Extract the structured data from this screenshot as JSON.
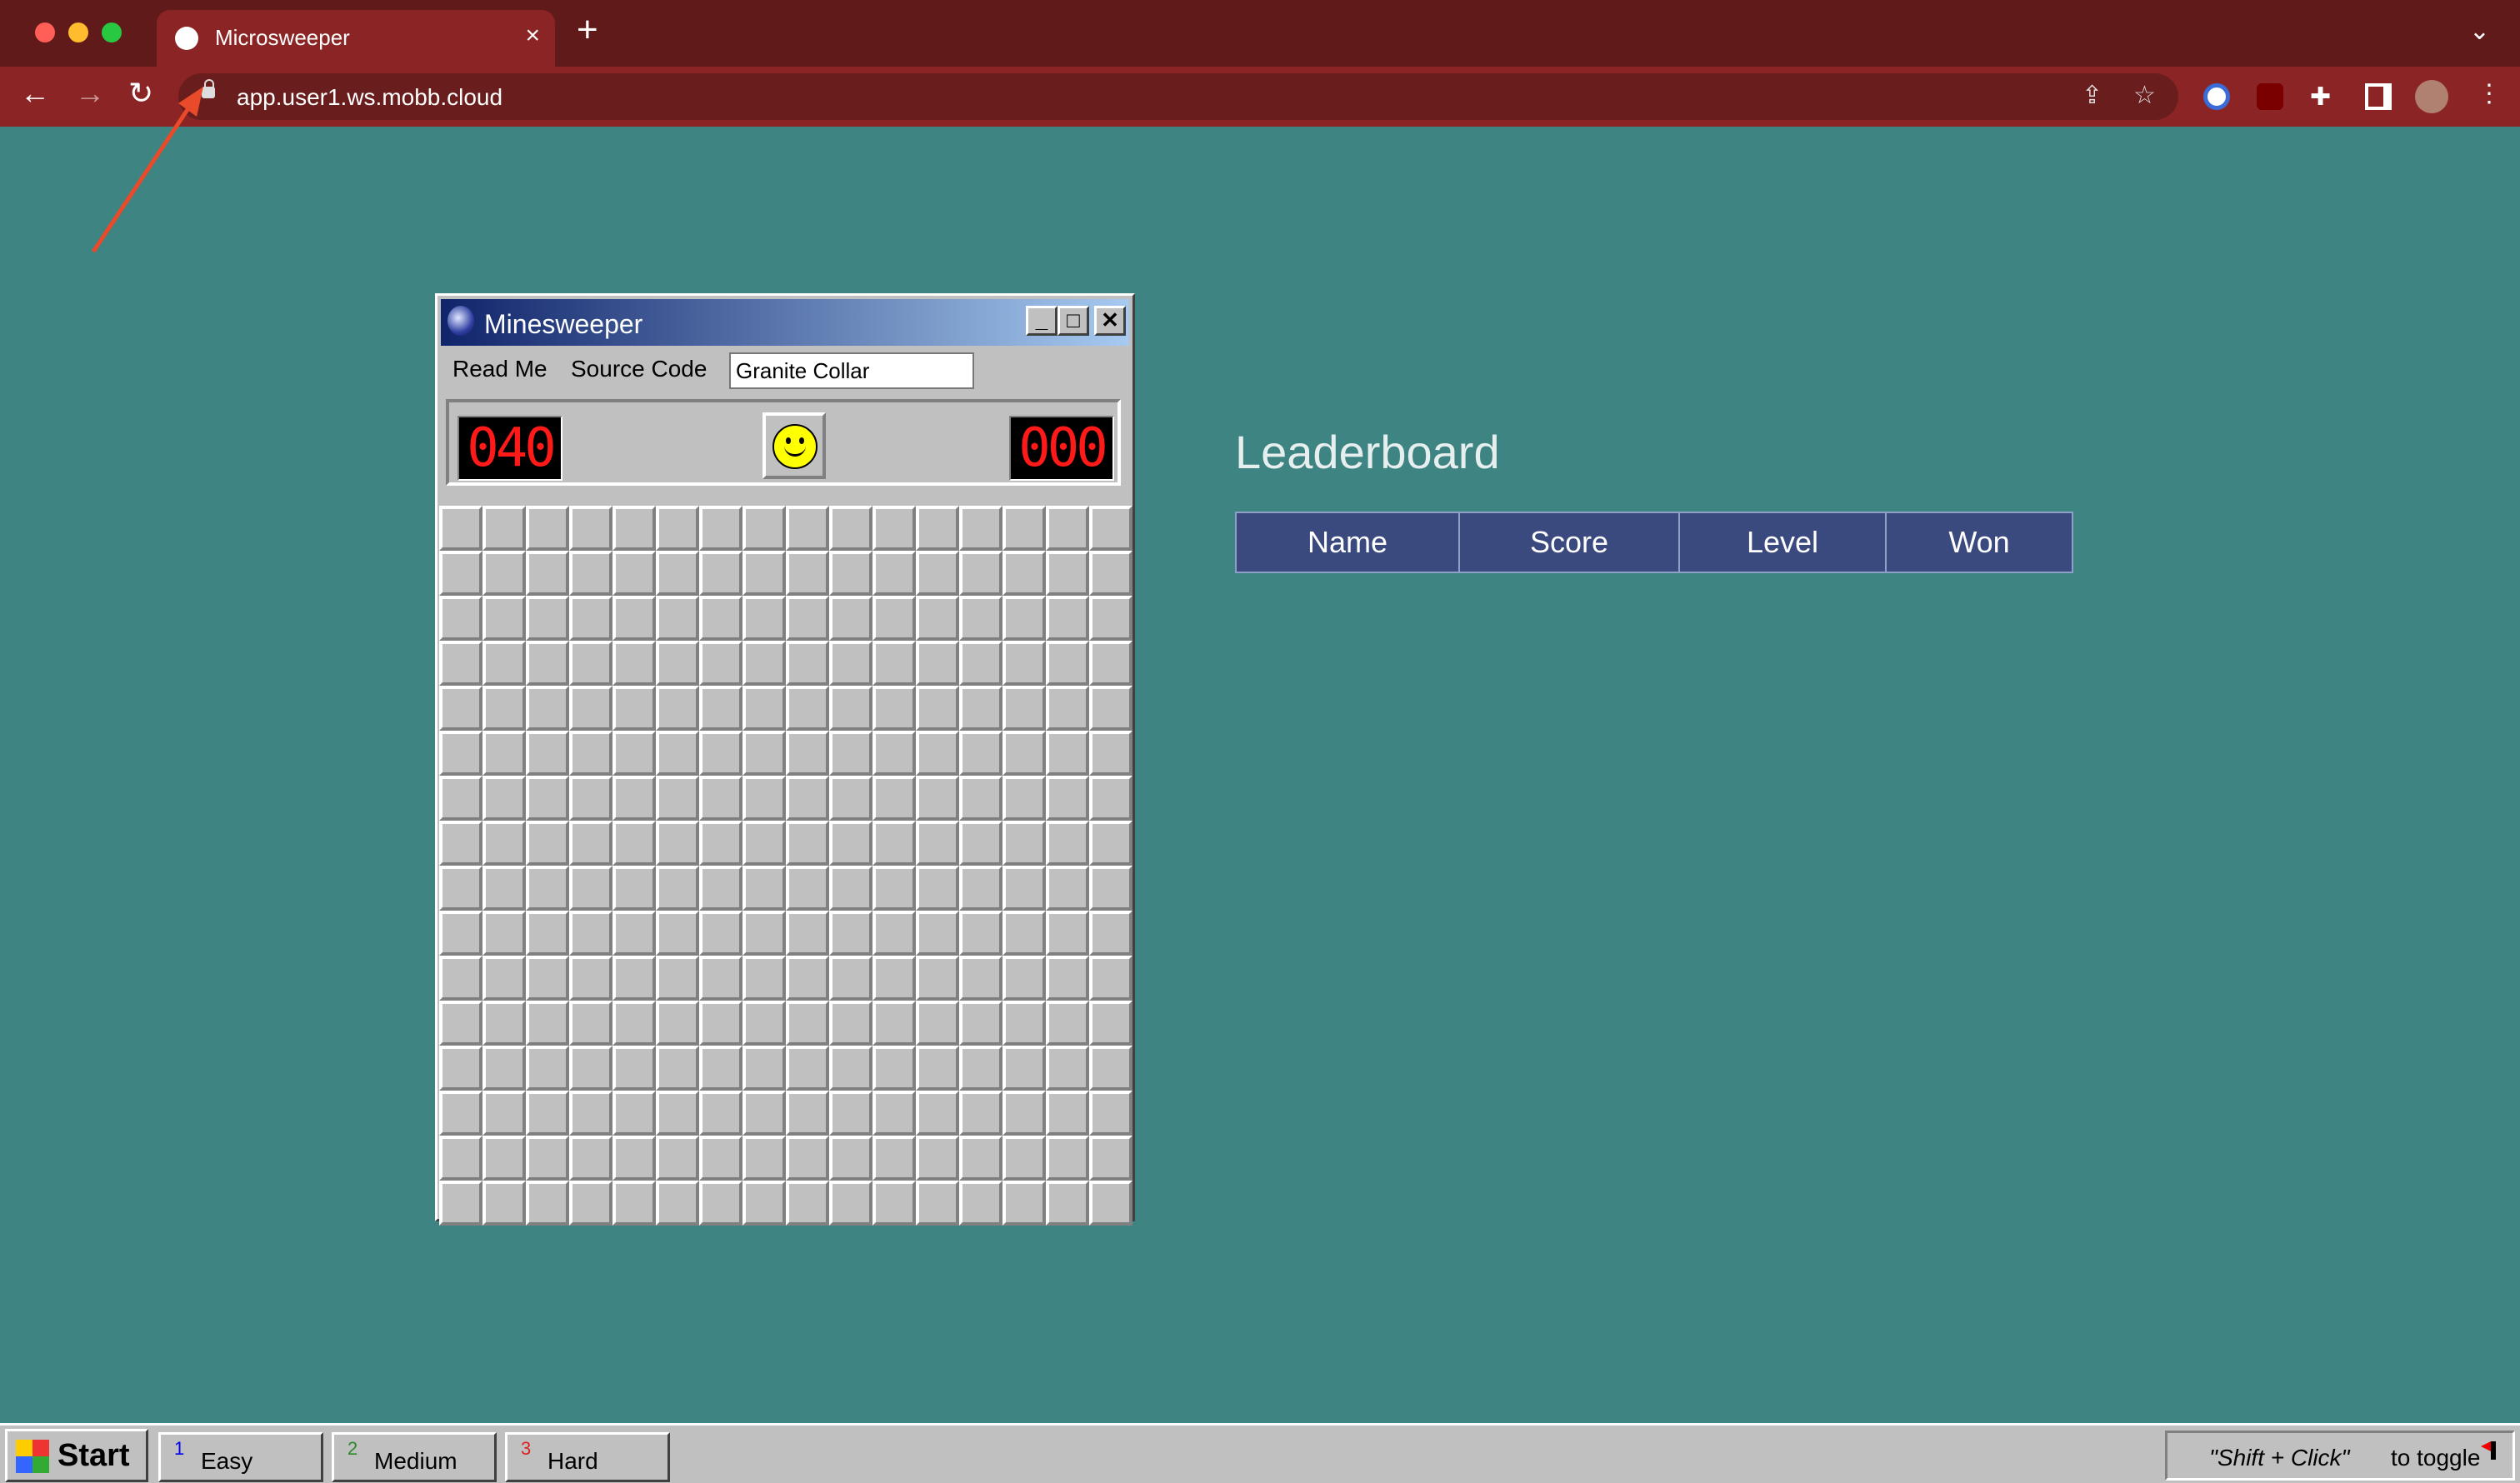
{
  "browser": {
    "tab_title": "Microsweeper",
    "tab_close": "×",
    "new_tab": "+",
    "url": "app.user1.ws.mobb.cloud"
  },
  "app": {
    "window_title": "Minesweeper",
    "min_glyph": "_",
    "max_glyph": "□",
    "close_glyph": "✕",
    "menu": {
      "read_me": "Read Me",
      "source_code": "Source Code"
    },
    "player_name": "Granite Collar",
    "mine_counter": "040",
    "timer": "000",
    "grid": {
      "rows": 16,
      "cols": 16
    }
  },
  "leaderboard": {
    "title": "Leaderboard",
    "columns": [
      "Name",
      "Score",
      "Level",
      "Won"
    ]
  },
  "taskbar": {
    "start_label": "Start",
    "levels": [
      {
        "num": "1",
        "label": "Easy",
        "color": "#0000ee"
      },
      {
        "num": "2",
        "label": "Medium",
        "color": "#2a8a2a"
      },
      {
        "num": "3",
        "label": "Hard",
        "color": "#dd2222"
      }
    ],
    "hint": "\"Shift + Click\"",
    "hint_suffix": "to toggle"
  },
  "colors": {
    "background": "#3d8482",
    "browser": "#8b2424",
    "header": "#3a4a7e",
    "annotation_arrow": "#e84a2a"
  }
}
